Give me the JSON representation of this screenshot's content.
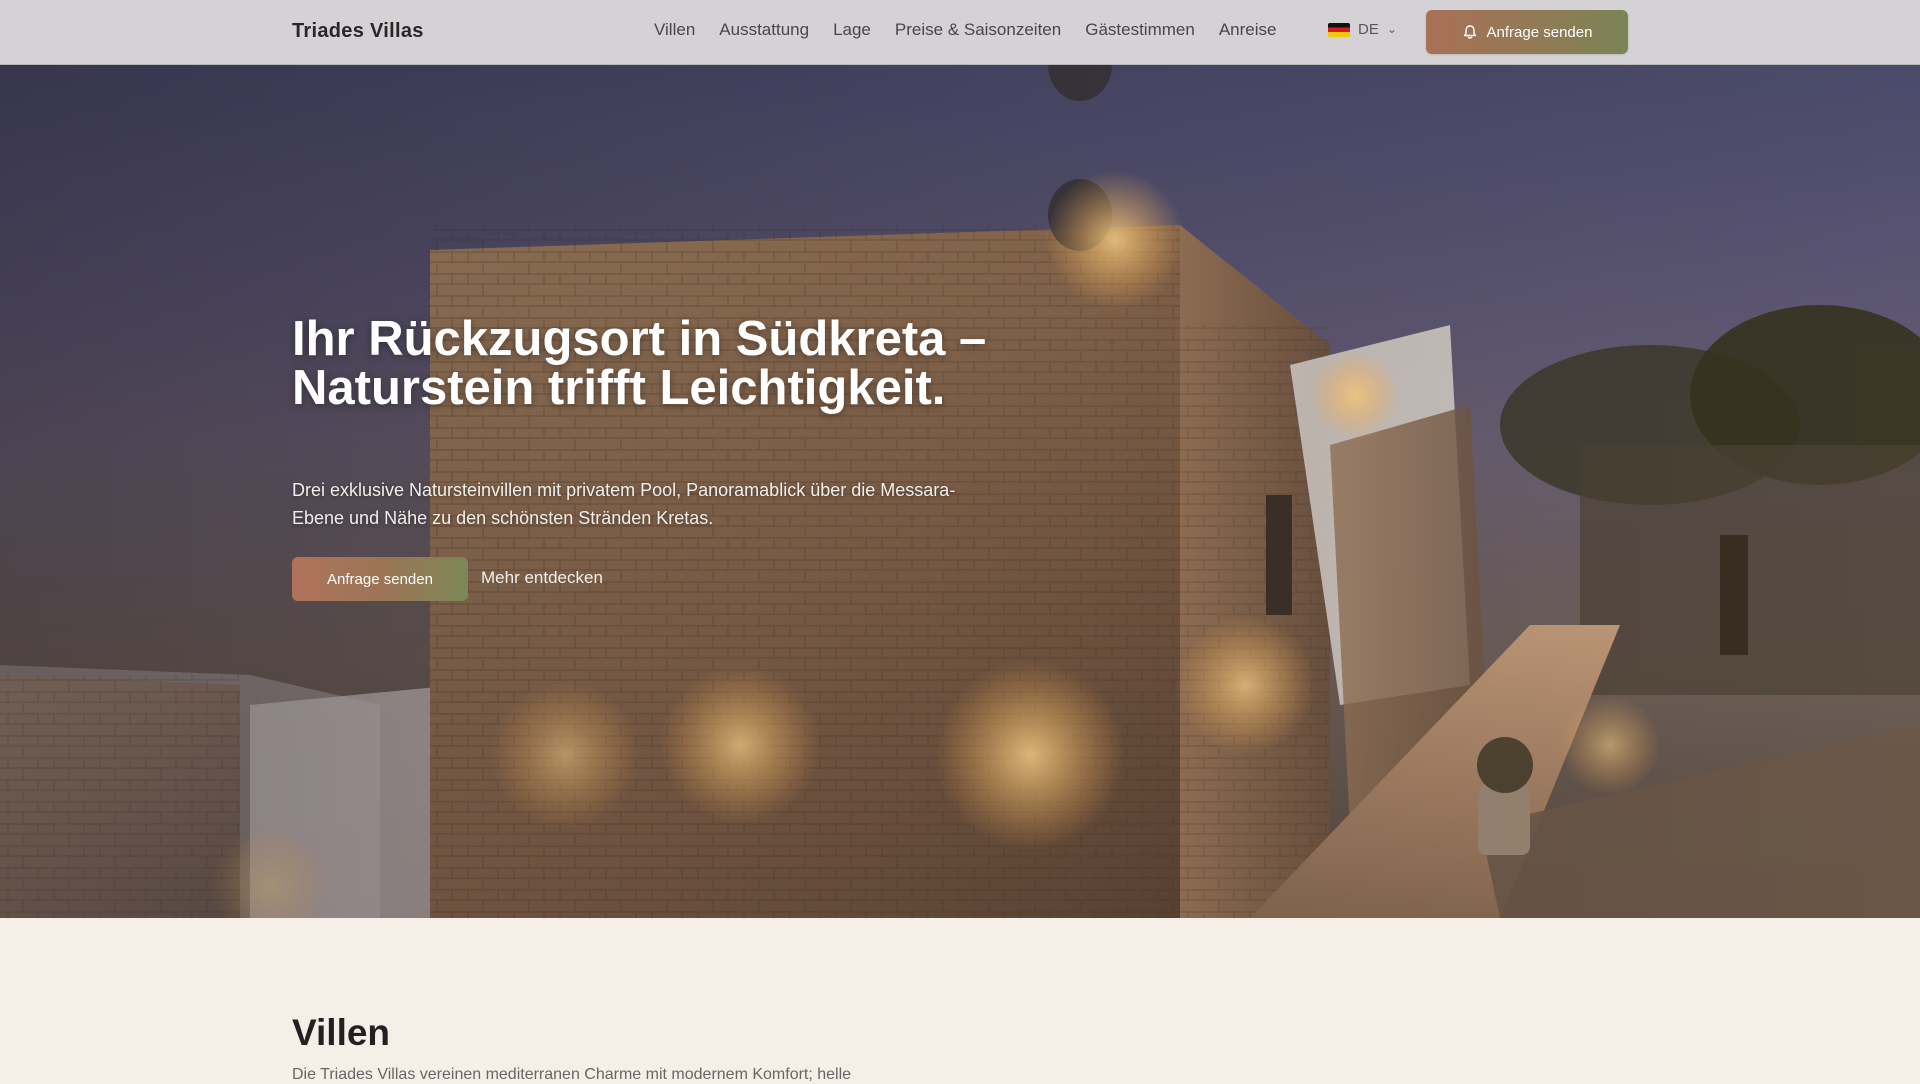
{
  "header": {
    "brand": "Triades Villas",
    "nav": [
      "Villen",
      "Ausstattung",
      "Lage",
      "Preise & Saisonzeiten",
      "Gästestimmen",
      "Anreise"
    ],
    "language": {
      "code": "DE",
      "flag": "german-flag"
    },
    "cta_label": "Anfrage senden",
    "cta_icon": "bell-icon"
  },
  "hero": {
    "title": "Ihr Rückzugsort in Südkreta – Naturstein trifft Leichtigkeit.",
    "subtitle": "Drei exklusive Natursteinvillen mit privatem Pool, Panoramablick über die Messara-Ebene und Nähe zu den schönsten Stränden Kretas.",
    "primary_button": "Anfrage senden",
    "secondary_link": "Mehr entdecken"
  },
  "villen": {
    "title": "Villen",
    "intro": "Die Triades Villas vereinen mediterranen Charme mit modernem Komfort; helle"
  },
  "colors": {
    "header_bg": "#d4d2d4",
    "page_bg": "#f6efe7",
    "cta_start": "#a87057",
    "cta_end": "#7a8456"
  }
}
